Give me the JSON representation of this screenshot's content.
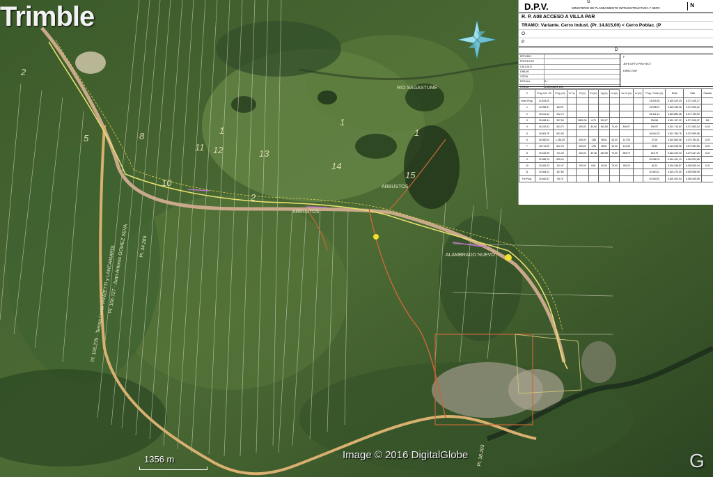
{
  "brand": "Trimble",
  "scale": {
    "label": "1356 m"
  },
  "copyright": "Image © 2016 DigitalGlobe",
  "google_mark": "G",
  "title_block": {
    "org": "D.P.V.",
    "g_mark": "G",
    "ministry": "MINISTERIO  DE  PLANEAMIENTO  INFRAESTRUCTURA  Y  SERV",
    "n_mark": "N",
    "route": "R.  P.  A08  ACCESO  A  VILLA  PAR",
    "tramo": "TRAMO:  Variante.  Cerro  Indust.  (Pr.  14.815,00)  <  Cerro  Poblac.  (P",
    "line_o": "O",
    "line_p": "P",
    "section_d": "D",
    "sign_rows": [
      "ESTUDIO",
      "PROYECTO",
      "CALCULO",
      "DIBUJO",
      "COPIA",
      "ESCALA",
      "FECHA"
    ],
    "sign_values": [
      "",
      "",
      "",
      "",
      "",
      "S /",
      "DICIEMBRE 201"
    ],
    "right_labels": [
      "F",
      "JEFE  DPTO  PROYECT",
      "DIRECTOR"
    ],
    "table": {
      "headers": [
        "V",
        "Prog. Inic. Pk",
        "Prog. (m)",
        "Vi \\ Vj",
        "R (m)",
        "Ex (m)",
        "Tg (m)",
        "Le (m)",
        "Ls en (m)",
        "Lc (m)",
        "Prog. / Cont. (m)",
        "Norte",
        "Este",
        "Parcela"
      ],
      "rows": [
        [
          "Inicio Prog.",
          "14.815,00",
          "",
          "",
          "",
          "",
          "",
          "",
          "",
          "",
          "14.815,00",
          "5.620.329,33",
          "6.272.245,17",
          ""
        ],
        [
          "1",
          "14.998,97",
          "183,97",
          "",
          "",
          "",
          "",
          "",
          "",
          "",
          "14.998,97",
          "5.620.435,36",
          "6.272.095,22",
          ""
        ],
        [
          "2",
          "15.411,41",
          "412,74",
          "",
          "",
          "",
          "",
          "",
          "",
          "",
          "15.411,41",
          "5.620.880,08",
          "6.271.750,50",
          ""
        ],
        [
          "3",
          "15.698,94",
          "287,53",
          "",
          "5890,00",
          "6,73",
          "199,97",
          "",
          "",
          "",
          "338,58",
          "5.621.157,32",
          "6.271.528,97",
          "8/6"
        ],
        [
          "4",
          "16.242,51",
          "543,73",
          "",
          "250,00",
          "30,60",
          "163,53",
          "70,00",
          "306,97",
          "",
          "196,97",
          "5.621.710,82",
          "6.271.053,24",
          "6,33"
        ],
        [
          "5",
          "16.904,75",
          "601,53",
          "",
          "",
          "",
          "",
          "",
          "",
          "",
          "16.904,75",
          "5.621.780,75",
          "6.270.999,98",
          ""
        ],
        [
          "6",
          "18.080,04",
          "1.184,35",
          "",
          "400,00",
          "1,88",
          "98,61",
          "40,00",
          "117,06",
          "",
          "27,06",
          "5.622.566,96",
          "6.270.784,51",
          "6,20"
        ],
        [
          "7",
          "18.711,09",
          "622,78",
          "",
          "400,00",
          "1,98",
          "98,61",
          "40,00",
          "113,45",
          "",
          "23,43",
          "5.623.045,96",
          "6.270.481,86",
          "6,20"
        ],
        [
          "8",
          "19.432,99",
          "721,49",
          "",
          "200,00",
          "39,48",
          "169,98",
          "70,00",
          "289,79",
          "",
          "149,79",
          "5.624.209,33",
          "6.270.447,20",
          "6,20"
        ],
        [
          "9",
          "20.088,76",
          "595,24",
          "",
          "",
          "",
          "",
          "",
          "",
          "",
          "20.088,76",
          "5.624.431,13",
          "6.269.923,88",
          ""
        ],
        [
          "10",
          "20.205,23",
          "131,47",
          "",
          "200,00",
          "8,81",
          "60,06",
          "70,00",
          "196,20",
          "",
          "46,20",
          "5.624.336,87",
          "6.269.930,34",
          "6,20"
        ],
        [
          "11",
          "20.364,11",
          "187,80",
          "",
          "",
          "",
          "",
          "",
          "",
          "",
          "20.364,11",
          "5.624.270,00",
          "6.269.538,95",
          ""
        ],
        [
          "Fin Prog.",
          "20.460,87",
          "96,76",
          "",
          "",
          "",
          "",
          "",
          "",
          "",
          "20.460,87",
          "5.624.300,94",
          "6.269.449,59",
          ""
        ]
      ]
    }
  },
  "map": {
    "parcel_numbers": [
      "2",
      "1",
      "1",
      "1",
      "13",
      "14",
      "15",
      "11",
      "12",
      "8",
      "5",
      "10",
      "2"
    ],
    "map_labels": [
      "ARBUSTOS",
      "ARBUSTOS",
      "ALAMBRADO NUEVO",
      "RIO SAGASTUME",
      "Pl. 34.285",
      "Pl. 106.727 · Juan Antonio GOMEZ SEVA",
      "Pl. 106.275 · Teresa Lucia VANZETTI y LANCAMARDI",
      "Pl. 38.203"
    ]
  }
}
